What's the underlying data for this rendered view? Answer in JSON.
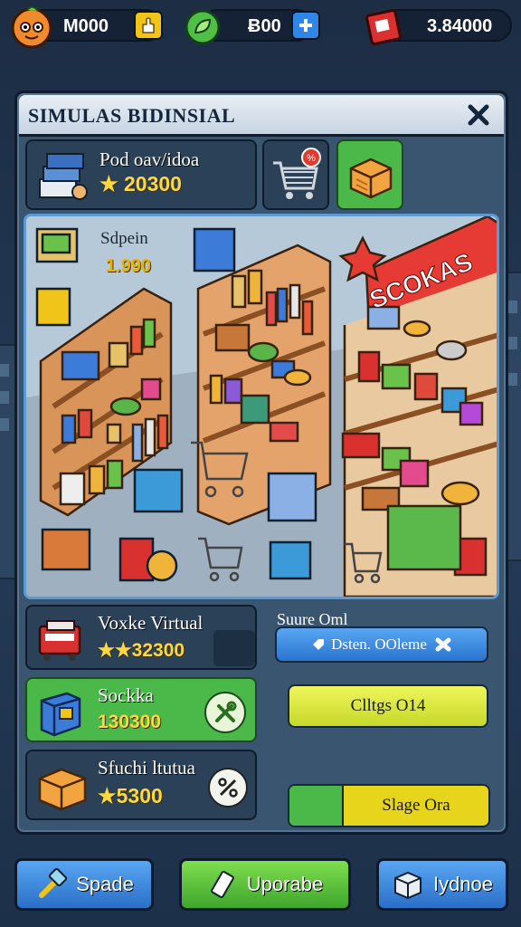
{
  "resources": {
    "coins": "M000",
    "gems": "Ƀ00",
    "cash": "3.84000"
  },
  "panel": {
    "title": "SIMULAS BIDINSIAL"
  },
  "top_cards": [
    {
      "name": "Pod oav/idoa",
      "value": "20300",
      "icon": "stock-stack-icon"
    },
    {
      "icon": "cart-sale-icon",
      "badge": "%"
    },
    {
      "icon": "crate-icon"
    }
  ],
  "scene": {
    "item_name": "Sdpein",
    "item_value": "1.990",
    "sign": "SCOKAS"
  },
  "item_cards": [
    {
      "name": "Voxke Virtual",
      "value": "32300",
      "prefix": "★★",
      "icon": "register-icon"
    },
    {
      "name": "Sockka",
      "value": "130300",
      "icon": "freezer-icon",
      "action_icon": "wrench-icon"
    },
    {
      "name": "Sfuchi ltutua",
      "value": "5300",
      "prefix": "★",
      "icon": "crate-icon",
      "action_icon": "percent-icon"
    }
  ],
  "right_controls": {
    "label": "Suure Oml",
    "blue_button": "Dsten. OOlemе",
    "yellow_button": "Clltgs O14",
    "split_button": "Slage Ora"
  },
  "bottom_bar": [
    {
      "label": "Spade",
      "icon": "hammer-icon"
    },
    {
      "label": "Uporabe",
      "icon": "pencil-icon"
    },
    {
      "label": "Iydnoe",
      "icon": "box-icon"
    }
  ],
  "colors": {
    "accent_green": "#5fcf3c",
    "accent_yellow": "#e6f046",
    "accent_blue": "#2f86e6",
    "value_gold": "#ffd93b"
  }
}
